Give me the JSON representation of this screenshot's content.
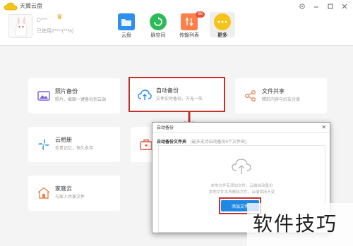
{
  "app": {
    "title": "天翼云盘"
  },
  "window": {
    "controls": [
      "settings-icon",
      "minimize-icon",
      "maximize-icon",
      "close-icon"
    ]
  },
  "user": {
    "name": "D***",
    "usage": "已使用2****(**%)"
  },
  "nav": {
    "items": [
      {
        "label": "云盘",
        "icon": "folder-icon",
        "color": "#2f8ff0"
      },
      {
        "label": "脉空间",
        "icon": "refresh-icon",
        "color": "#2dbb5a"
      },
      {
        "label": "传输列表",
        "icon": "transfer-icon",
        "color": "#ff7f4a",
        "badge": "66"
      },
      {
        "label": "更多",
        "icon": "more-icon",
        "color": "#f5c418"
      }
    ]
  },
  "cards": [
    {
      "id": "photo-backup",
      "title": "照片备份",
      "desc": "照片、截图一键备份到云端",
      "icon": "photo-icon",
      "color": "#7b61d8"
    },
    {
      "id": "auto-backup",
      "title": "自动备份",
      "desc": "文件实时备份，万无一失",
      "icon": "cloud-upload-icon",
      "color": "#2f8ff0"
    },
    {
      "id": "file-share",
      "title": "文件共享",
      "desc": "精彩内容与好友分享",
      "icon": "share-icon",
      "color": "#e08a5b"
    },
    {
      "id": "cloud-album",
      "title": "云相册",
      "desc": "珍贵记忆，恒久永存",
      "icon": "pinwheel-icon",
      "color": "#4aa3df"
    },
    {
      "id": "hidden-card",
      "title": "",
      "desc": "",
      "icon": "briefcase-icon",
      "color": "#e5533d"
    },
    {
      "id": "family-cloud",
      "title": "家庭云",
      "desc": "与家人共享文件",
      "icon": "house-icon",
      "color": "#e0884d"
    }
  ],
  "dialog": {
    "title": "自动备份",
    "section_title": "自动备份文件夹",
    "section_hint": "(最多支持自动备份5个文件夹)",
    "empty_line1": "本地文件有添加文件，云端自动备份",
    "empty_line2": "本地文件夹再删除文件，云端保持不变",
    "add_button": "添加文件"
  },
  "colors": {
    "highlight": "#c0322b",
    "primary": "#1e88e5"
  },
  "watermark": "软件技巧"
}
